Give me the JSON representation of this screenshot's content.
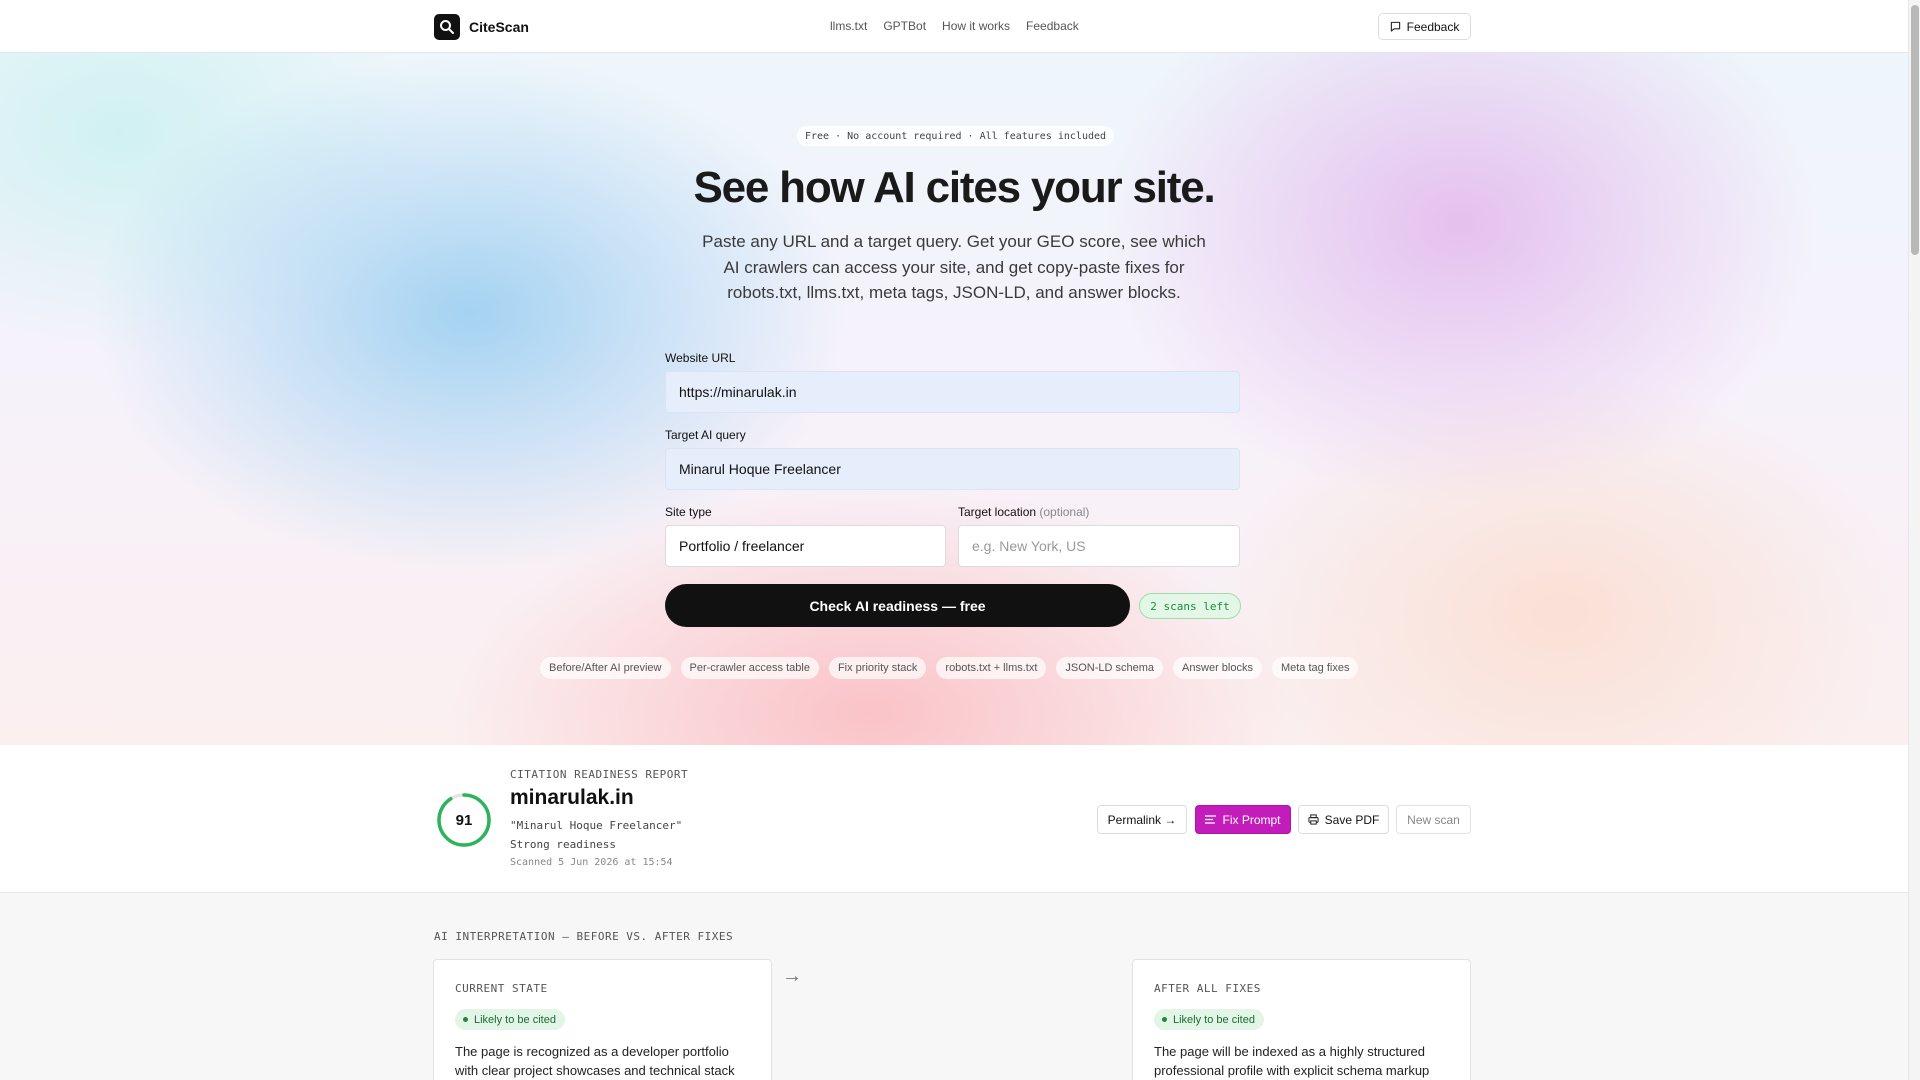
{
  "header": {
    "brand": "CiteScan",
    "nav": [
      "llms.txt",
      "GPTBot",
      "How it works",
      "Feedback"
    ],
    "feedback_button": "Feedback"
  },
  "hero": {
    "badge": "Free · No account required · All features included",
    "title": "See how AI cites your site.",
    "subtitle": "Paste any URL and a target query. Get your GEO score, see which AI crawlers can access your site, and get copy-paste fixes for robots.txt, llms.txt, meta tags, JSON-LD, and answer blocks."
  },
  "form": {
    "url_label": "Website URL",
    "url_value": "https://minarulak.in",
    "query_label": "Target AI query",
    "query_value": "Minarul Hoque Freelancer",
    "site_type_label": "Site type",
    "site_type_value": "Portfolio / freelancer",
    "location_label": "Target location",
    "location_optional": "(optional)",
    "location_placeholder": "e.g. New York, US",
    "submit": "Check AI readiness — free",
    "scans_left": "2 scans left"
  },
  "feature_chips": [
    "Before/After AI preview",
    "Per-crawler access table",
    "Fix priority stack",
    "robots.txt + llms.txt",
    "JSON-LD schema",
    "Answer blocks",
    "Meta tag fixes"
  ],
  "report": {
    "label": "CITATION READINESS REPORT",
    "score": 91,
    "score_fraction": 0.91,
    "score_color": "#2bb45a",
    "domain": "minarulak.in",
    "query": "\"Minarul Hoque Freelancer\"",
    "strength": "Strong readiness",
    "scanned": "Scanned 5 Jun 2026 at 15:54",
    "actions": {
      "permalink": "Permalink →",
      "fix_prompt": "Fix Prompt",
      "save_pdf": "Save PDF",
      "new_scan": "New scan"
    },
    "accent_color": "#c21dbb"
  },
  "comparison": {
    "heading": "AI INTERPRETATION — BEFORE VS. AFTER FIXES",
    "arrow": "→",
    "current": {
      "label": "CURRENT STATE",
      "badge": "Likely to be cited",
      "text": "The page is recognized as a developer portfolio with clear project showcases and technical stack"
    },
    "after": {
      "label": "AFTER ALL FIXES",
      "badge": "Likely to be cited",
      "text": "The page will be indexed as a highly structured professional profile with explicit schema markup"
    }
  }
}
